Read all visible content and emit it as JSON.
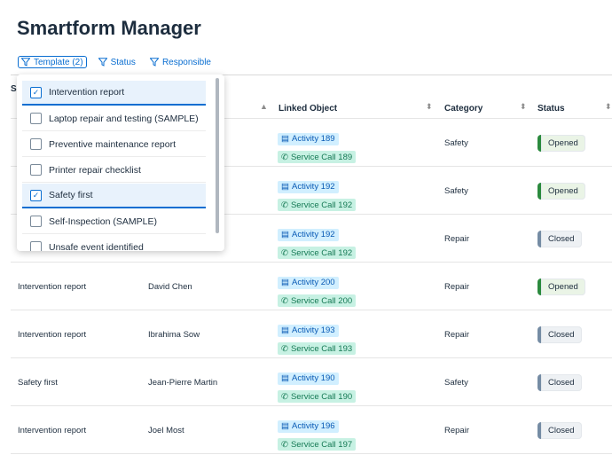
{
  "page": {
    "title": "Smartform Manager"
  },
  "filters": [
    {
      "label": "Template (2)",
      "active": true
    },
    {
      "label": "Status",
      "active": false
    },
    {
      "label": "Responsible",
      "active": false
    }
  ],
  "table": {
    "first_header_fragment": "S",
    "columns": [
      "Linked Object",
      "Category",
      "Status"
    ],
    "rows": [
      {
        "template": "",
        "responsible": "",
        "activity": "Activity 189",
        "call": "Service Call 189",
        "category": "Safety",
        "status": "Opened"
      },
      {
        "template": "",
        "responsible": "",
        "activity": "Activity 192",
        "call": "Service Call 192",
        "category": "Safety",
        "status": "Opened"
      },
      {
        "template": "",
        "responsible": "",
        "activity": "Activity 192",
        "call": "Service Call 192",
        "category": "Repair",
        "status": "Closed"
      },
      {
        "template": "Intervention report",
        "responsible": "David Chen",
        "activity": "Activity 200",
        "call": "Service Call 200",
        "category": "Repair",
        "status": "Opened"
      },
      {
        "template": "Intervention report",
        "responsible": "Ibrahima Sow",
        "activity": "Activity 193",
        "call": "Service Call 193",
        "category": "Repair",
        "status": "Closed"
      },
      {
        "template": "Safety first",
        "responsible": "Jean-Pierre Martin",
        "activity": "Activity 190",
        "call": "Service Call 190",
        "category": "Safety",
        "status": "Closed"
      },
      {
        "template": "Intervention report",
        "responsible": "Joel Most",
        "activity": "Activity 196",
        "call": "Service Call 197",
        "category": "Repair",
        "status": "Closed"
      }
    ]
  },
  "dropdown": {
    "options": [
      {
        "label": "Intervention report",
        "checked": true
      },
      {
        "label": "Laptop repair and testing (SAMPLE)",
        "checked": false
      },
      {
        "label": "Preventive maintenance report",
        "checked": false
      },
      {
        "label": "Printer repair checklist",
        "checked": false
      },
      {
        "label": "Safety first",
        "checked": true
      },
      {
        "label": "Self-Inspection (SAMPLE)",
        "checked": false
      },
      {
        "label": "Unsafe event identified",
        "checked": false
      }
    ]
  },
  "colors": {
    "accent": "#0a6ed1",
    "opened": "#2b8a3e",
    "closed": "#758ca4"
  }
}
